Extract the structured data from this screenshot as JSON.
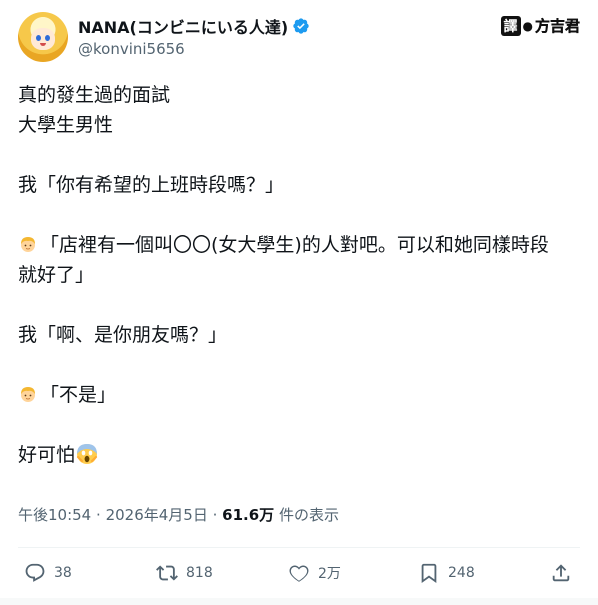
{
  "author": {
    "display_name": "NANA(コンビニにいる人達)",
    "handle": "@konvini5656"
  },
  "brand": {
    "badge": "譯",
    "name": "方吉君"
  },
  "tweet": {
    "lines": [
      "真的發生過的面試",
      "大學生男性",
      "我「你有希望的上班時段嗎？」",
      "「店裡有一個叫〇〇(女大學生)的人對吧。可以和她同樣時段",
      "就好了」",
      "我「啊、是你朋友嗎？」",
      "「不是」",
      "好可怕"
    ]
  },
  "meta": {
    "time": "午後10:54",
    "date": "2026年4月5日",
    "views_count": "61.6万",
    "views_label": "件の表示"
  },
  "actions": {
    "replies": "38",
    "retweets": "818",
    "likes": "2万",
    "bookmarks": "248"
  },
  "colors": {
    "verified": "#1d9bf0",
    "text": "#0f1419",
    "muted": "#536471"
  }
}
